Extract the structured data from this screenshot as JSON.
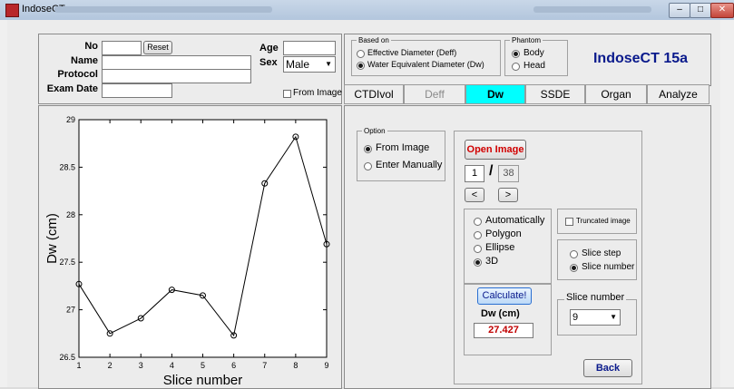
{
  "window": {
    "title": "IndoseCT",
    "min": "–",
    "max": "□",
    "close": "✕",
    "accent": "#00ffff"
  },
  "patient": {
    "no_label": "No",
    "no_value": "",
    "name_label": "Name",
    "name_value": "",
    "protocol_label": "Protocol",
    "protocol_value": "",
    "examdate_label": "Exam Date",
    "examdate_value": "",
    "age_label": "Age",
    "age_value": "",
    "sex_label": "Sex",
    "sex_value": "Male",
    "reset_label": "Reset",
    "from_image_label": "From Image"
  },
  "based_on": {
    "title": "Based on",
    "opt1": "Effective Diameter (Deff)",
    "opt2": "Water Equivalent Diameter (Dw)",
    "selected": 2
  },
  "phantom": {
    "title": "Phantom",
    "opt1": "Body",
    "opt2": "Head",
    "selected": 1
  },
  "app_name": "IndoseCT 15a",
  "tabs": [
    {
      "label": "CTDIvol"
    },
    {
      "label": "Deff"
    },
    {
      "label": "Dw"
    },
    {
      "label": "SSDE"
    },
    {
      "label": "Organ"
    },
    {
      "label": "Analyze"
    }
  ],
  "active_tab": 2,
  "option": {
    "title": "Option",
    "opt1": "From Image",
    "opt2": "Enter Manually",
    "selected": 1
  },
  "controls": {
    "open_image": "Open Image",
    "current_slice": "1",
    "slash": "/",
    "total_slices": "38",
    "prev": "<",
    "next": ">",
    "method": [
      "Automatically",
      "Polygon",
      "Ellipse",
      "3D"
    ],
    "method_selected": 3,
    "truncated_label": "Truncated image",
    "slice_mode": [
      "Slice step",
      "Slice number"
    ],
    "slice_mode_selected": 1,
    "calculate": "Calculate!",
    "dw_label": "Dw (cm)",
    "dw_value": "27.427",
    "slice_number_title": "Slice number",
    "slice_number_value": "9",
    "back": "Back"
  },
  "chart_data": {
    "type": "line",
    "xlabel": "Slice number",
    "ylabel": "Dw (cm)",
    "x": [
      1,
      2,
      3,
      4,
      5,
      6,
      7,
      8,
      9
    ],
    "y": [
      27.27,
      26.75,
      26.91,
      27.21,
      27.15,
      26.73,
      28.33,
      28.82,
      27.69
    ],
    "xlim": [
      1,
      9
    ],
    "ylim": [
      26.5,
      29
    ],
    "xticks": [
      "1",
      "2",
      "3",
      "4",
      "5",
      "6",
      "7",
      "8",
      "9"
    ],
    "yticks": [
      "26.5",
      "27",
      "27.5",
      "28",
      "28.5",
      "29"
    ],
    "marker": "circle",
    "grid": false
  }
}
